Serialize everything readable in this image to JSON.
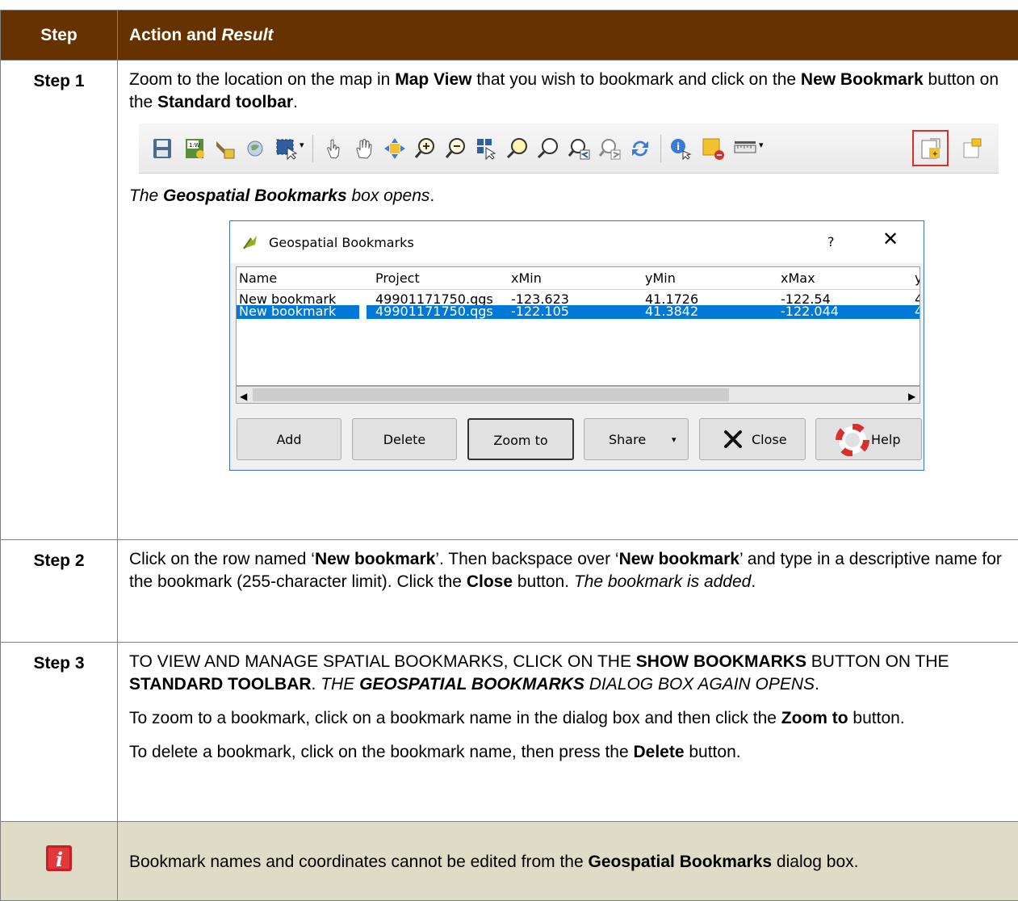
{
  "header": {
    "step": "Step",
    "action_prefix": "Action and ",
    "action_italic": "Result"
  },
  "step1": {
    "label": "Step 1",
    "t1": "Zoom to the location on the map in ",
    "b1": "Map View",
    "t2": " that you wish to bookmark and click on the ",
    "b2": "New Bookmark",
    "t3": " button on the ",
    "b3": "Standard toolbar",
    "t4": ".",
    "toolbar_icons": [
      "save-icon",
      "new-print-layout-icon",
      "pan-to-selection-icon",
      "identify-globe-icon",
      "select-features-icon",
      "touch-zoom-icon",
      "pan-hand-icon",
      "pan-map-icon",
      "zoom-in-icon",
      "zoom-out-icon",
      "zoom-to-selection-icon",
      "zoom-to-layer-icon",
      "zoom-full-icon",
      "zoom-last-icon",
      "zoom-next-icon",
      "refresh-icon",
      "identify-features-icon",
      "deselect-icon",
      "measure-icon",
      "new-bookmark-icon",
      "show-bookmarks-icon"
    ],
    "result_i1": "The ",
    "result_b": "Geospatial Bookmarks",
    "result_i2": " box opens",
    "result_end": "."
  },
  "dialog": {
    "title": "Geospatial Bookmarks",
    "help_glyph": "?",
    "close_glyph": "✕",
    "columns": [
      "Name",
      "Project",
      "xMin",
      "yMin",
      "xMax",
      "yM"
    ],
    "rows": [
      [
        "New bookmark",
        "49901171750.qgs",
        "-123.623",
        "41.1726",
        "-122.54",
        "4"
      ],
      [
        "New bookmark",
        "49901171750.qgs",
        "-122.105",
        "41.3842",
        "-122.044",
        "4"
      ]
    ],
    "buttons": {
      "add": "Add",
      "delete": "Delete",
      "zoom": "Zoom to",
      "share": "Share",
      "close": "Close",
      "help": "Help"
    },
    "colors": {
      "selection": "#0078d7"
    }
  },
  "step2": {
    "label": "Step 2",
    "t1": "Click on the row named ‘",
    "b1": "New bookmark",
    "t2": "’. Then backspace over ‘",
    "b2": "New bookmark",
    "t3": "’ and type in a descriptive name for the bookmark (255-character limit). Click the ",
    "b3": "Close",
    "t4": " button. ",
    "i1": "The bookmark is added",
    "t5": "."
  },
  "step3": {
    "label": "Step 3",
    "p1_t1": "To view and manage spatial bookmarks, click on the ",
    "p1_b1": "Show Bookmarks",
    "p1_t2": " button on the ",
    "p1_b2": "Standard toolbar",
    "p1_t3": ". ",
    "p1_i1": "The ",
    "p1_ib": "Geospatial Bookmarks",
    "p1_i2": " dialog box again opens",
    "p1_t4": ".",
    "p2_t1": "To zoom to a bookmark, click on a bookmark name in the dialog box and then click the ",
    "p2_b1": "Zoom to",
    "p2_t2": " button.",
    "p3_t1": "To delete a bookmark, click on the bookmark name, then press the ",
    "p3_b1": "Delete",
    "p3_t2": " button."
  },
  "note": {
    "icon": "info-icon",
    "t1": "Bookmark names and coordinates cannot be edited from the ",
    "b1": "Geospatial Bookmarks",
    "t2": " dialog box."
  },
  "colors": {
    "header_bg": "#663300",
    "note_bg": "#dedbc6",
    "highlight": "#d9302c"
  }
}
